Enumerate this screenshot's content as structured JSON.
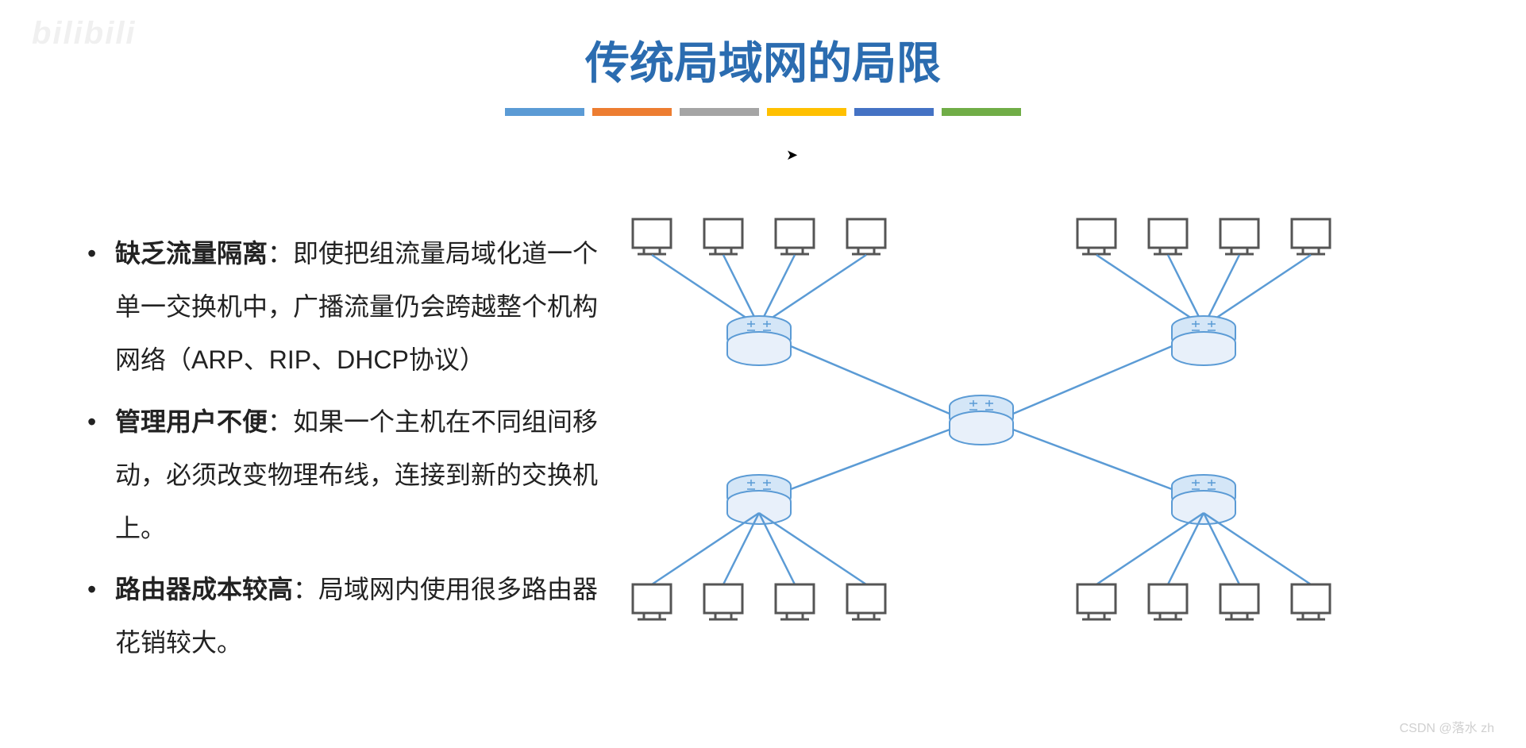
{
  "watermark": {
    "top": "bilibili",
    "bottom": "CSDN @落水 zh"
  },
  "title": "传统局域网的局限",
  "colorBars": [
    "#5b9bd5",
    "#ed7d31",
    "#a5a5a5",
    "#ffc000",
    "#4472c4",
    "#70ad47"
  ],
  "bullets": [
    {
      "bold": "缺乏流量隔离",
      "text": "：即使把组流量局域化道一个单一交换机中，广播流量仍会跨越整个机构网络（ARP、RIP、DHCP协议）"
    },
    {
      "bold": "管理用户不便",
      "text": "：如果一个主机在不同组间移动，必须改变物理布线，连接到新的交换机上。"
    },
    {
      "bold": "路由器成本较高",
      "text": "：局域网内使用很多路由器花销较大。"
    }
  ],
  "diagram": {
    "description": "Network topology with central switch connected to 4 edge switches, each edge switch connected to 4 computers",
    "nodes": {
      "topComputers": 8,
      "bottomComputers": 8,
      "edgeSwitches": 4,
      "centralSwitch": 1
    }
  }
}
